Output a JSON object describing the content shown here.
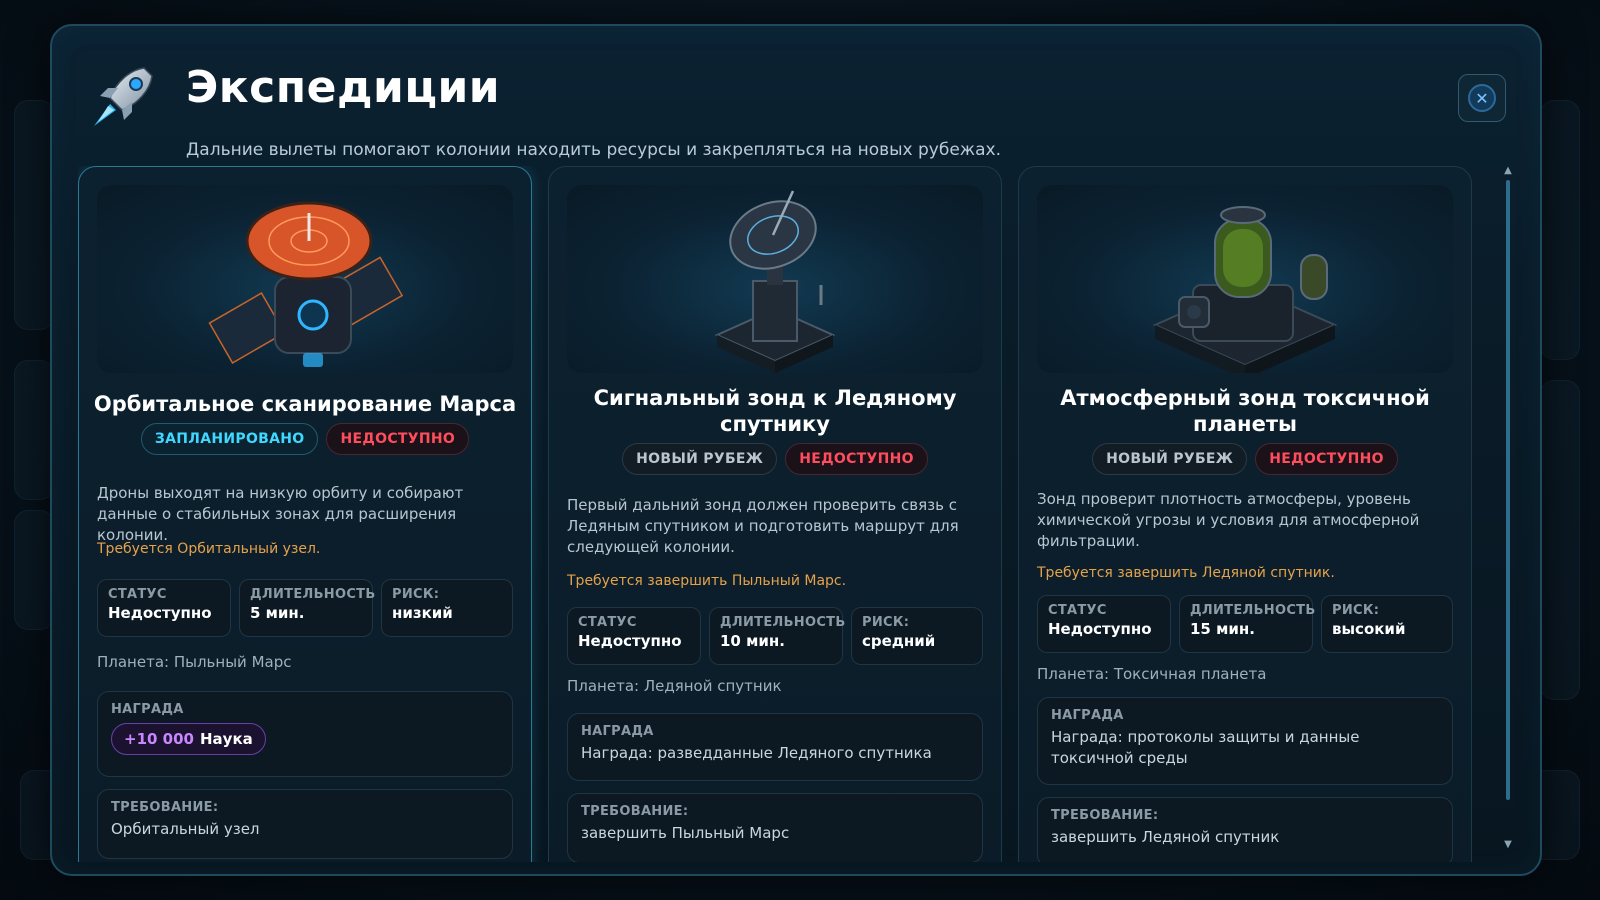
{
  "header": {
    "title": "Экспедиции",
    "subtitle": "Дальние вылеты помогают колонии находить ресурсы и закрепляться на новых рубежах.",
    "close_icon": "close-icon"
  },
  "labels": {
    "status": "СТАТУС",
    "duration": "ДЛИТЕЛЬНОСТЬ",
    "risk": "РИСК:",
    "reward": "НАГРАДА",
    "requirement": "ТРЕБОВАНИЕ:"
  },
  "cards": [
    {
      "title": "Орбитальное сканирование Марса",
      "badges": [
        "ЗАПЛАНИРОВАНО",
        "НЕДОСТУПНО"
      ],
      "description": "Дроны выходят на низкую орбиту и собирают данные о стабильных зонах для расширения колонии.",
      "requirement_note": "Требуется Орбитальный узел.",
      "status": "Недоступно",
      "duration": "5 мин.",
      "risk": "низкий",
      "planet": "Планета: Пыльный Марс",
      "reward_amount": "+10 000",
      "reward_resource": "Наука",
      "requirement": "Орбитальный узел"
    },
    {
      "title": "Сигнальный зонд к Ледяному спутнику",
      "badges": [
        "НОВЫЙ РУБЕЖ",
        "НЕДОСТУПНО"
      ],
      "description": "Первый дальний зонд должен проверить связь с Ледяным спутником и подготовить маршрут для следующей колонии.",
      "requirement_note": "Требуется завершить Пыльный Марс.",
      "status": "Недоступно",
      "duration": "10 мин.",
      "risk": "средний",
      "planet": "Планета: Ледяной спутник",
      "reward_text": "Награда: разведданные Ледяного спутника",
      "requirement": "завершить Пыльный Марс"
    },
    {
      "title": "Атмосферный зонд токсичной планеты",
      "badges": [
        "НОВЫЙ РУБЕЖ",
        "НЕДОСТУПНО"
      ],
      "description": "Зонд проверит плотность атмосферы, уровень химической угрозы и условия для атмосферной фильтрации.",
      "requirement_note": "Требуется завершить Ледяной спутник.",
      "status": "Недоступно",
      "duration": "15 мин.",
      "risk": "высокий",
      "planet": "Планета: Токсичная планета",
      "reward_text": "Награда: протоколы защиты и данные токсичной среды",
      "requirement": "завершить Ледяной спутник"
    }
  ],
  "colors": {
    "accent_cyan": "#3fd8ff",
    "unavailable_red": "#ff4d5e",
    "requirement_orange": "#e5a24a",
    "reward_purple": "#c887ff"
  }
}
